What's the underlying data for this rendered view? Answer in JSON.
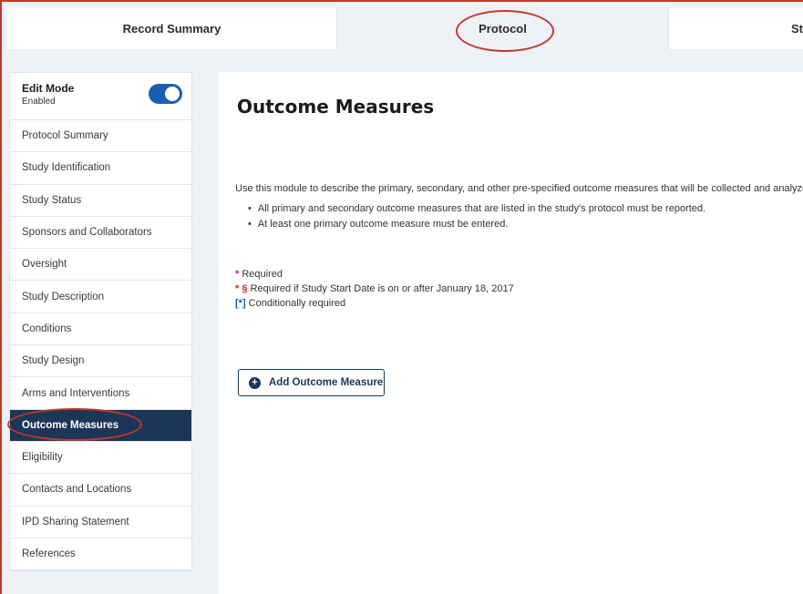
{
  "tabs": [
    {
      "label": "Record Summary"
    },
    {
      "label": "Protocol"
    },
    {
      "label": "St"
    }
  ],
  "sidebar": {
    "edit_mode": {
      "title": "Edit Mode",
      "status": "Enabled",
      "on": true
    },
    "items": [
      {
        "label": "Protocol Summary"
      },
      {
        "label": "Study Identification"
      },
      {
        "label": "Study Status"
      },
      {
        "label": "Sponsors and Collaborators"
      },
      {
        "label": "Oversight"
      },
      {
        "label": "Study Description"
      },
      {
        "label": "Conditions"
      },
      {
        "label": "Study Design"
      },
      {
        "label": "Arms and Interventions"
      },
      {
        "label": "Outcome Measures",
        "active": true
      },
      {
        "label": "Eligibility"
      },
      {
        "label": "Contacts and Locations"
      },
      {
        "label": "IPD Sharing Statement"
      },
      {
        "label": "References"
      }
    ]
  },
  "main": {
    "title": "Outcome Measures",
    "intro": "Use this module to describe the primary, secondary, and other pre-specified outcome measures that will be collected and analyze",
    "bullets": [
      "All primary and secondary outcome measures that are listed in the study's protocol must be reported.",
      "At least one primary outcome measure must be entered."
    ],
    "legend": {
      "required_mark": "*",
      "required": "Required",
      "section_mark": "* §",
      "section_required": "Required if Study Start Date is on or after January 18, 2017",
      "conditional_mark": "[*]",
      "conditional": "Conditionally required"
    },
    "add_button": "Add Outcome Measure"
  },
  "colors": {
    "accent": "#1d3557",
    "toggle": "#1a5fb4",
    "required": "#c62828",
    "annotation": "#c0392b"
  }
}
